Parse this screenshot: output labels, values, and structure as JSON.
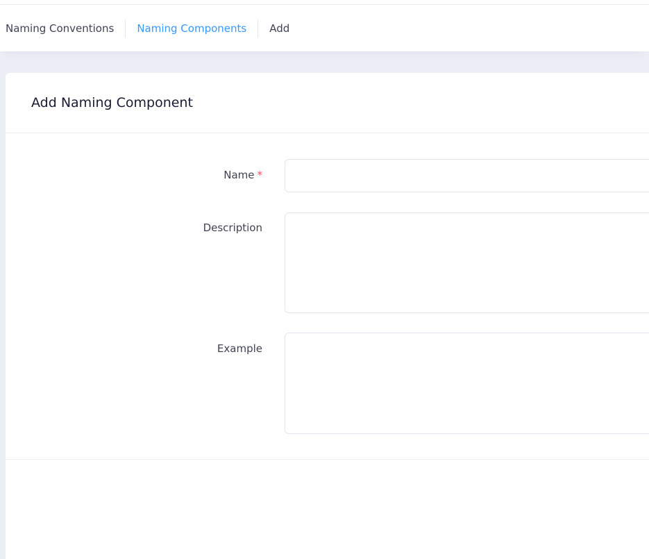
{
  "breadcrumb": {
    "items": [
      {
        "label": "Naming Conventions"
      },
      {
        "label": "Naming Components"
      },
      {
        "label": "Add"
      }
    ]
  },
  "card": {
    "title": "Add Naming Component"
  },
  "form": {
    "name": {
      "label": "Name",
      "required_mark": "*",
      "value": "",
      "placeholder": ""
    },
    "description": {
      "label": "Description",
      "value": "",
      "placeholder": ""
    },
    "example": {
      "label": "Example",
      "value": "",
      "placeholder": ""
    }
  },
  "colors": {
    "active_link": "#3699ff",
    "required": "#f64e60",
    "page_background": "#eceef6"
  }
}
